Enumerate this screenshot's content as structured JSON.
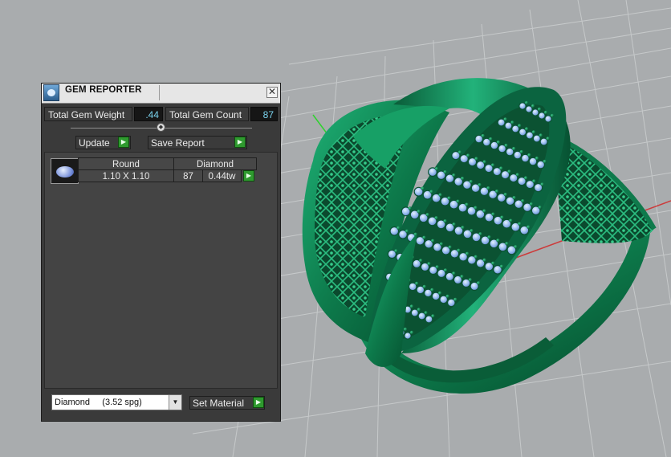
{
  "panel": {
    "title": "GEM REPORTER",
    "close_glyph": "✕",
    "total_gem_weight_label": "Total Gem Weight",
    "total_gem_weight_value": ".44",
    "total_gem_count_label": "Total Gem Count",
    "total_gem_count_value": "87",
    "update_label": "Update",
    "save_report_label": "Save Report",
    "go_glyph": "▶",
    "gem_table": {
      "headers": [
        "Round",
        "Diamond"
      ],
      "rows": [
        {
          "size": "1.10 X 1.10",
          "count": "87",
          "weight": "0.44tw"
        }
      ]
    },
    "material_select": {
      "selected": "Diamond     (3.52 spg)"
    },
    "set_material_label": "Set Material"
  },
  "viewport": {
    "model": "ring",
    "metal_color": "#0f7a4c",
    "gem_color": "#9fc4f2",
    "grid_color": "#c9cbcc",
    "background_color": "#a9acae"
  }
}
